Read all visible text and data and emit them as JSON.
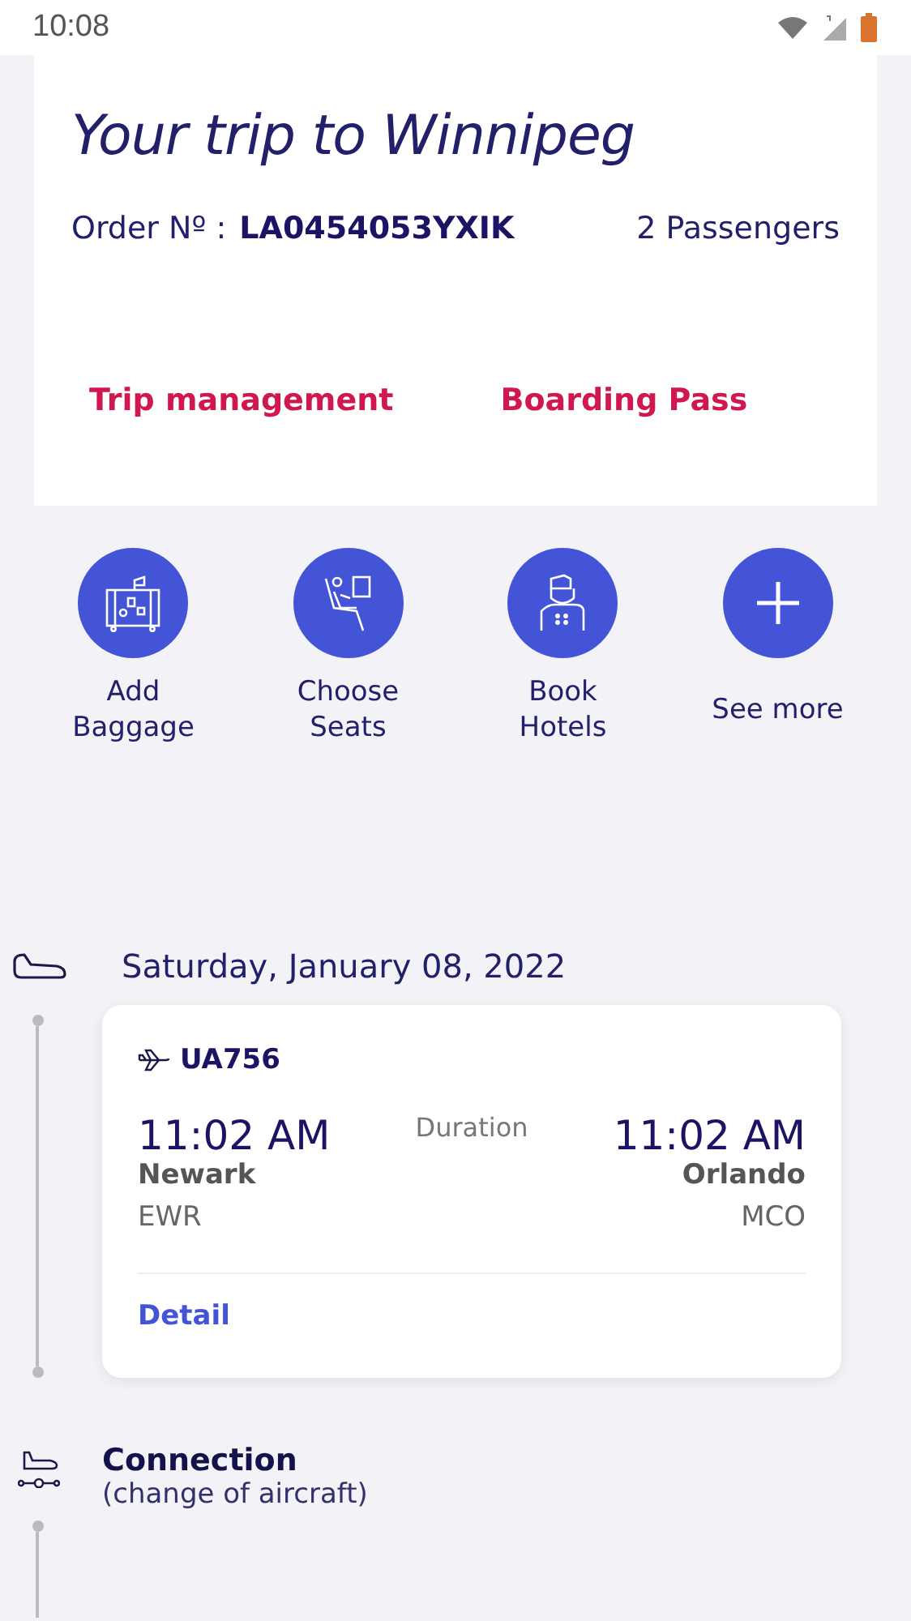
{
  "status_bar": {
    "time": "10:08"
  },
  "trip": {
    "title": "Your trip to Winnipeg",
    "order_label": "Order Nº :",
    "order_number": "LA0454053YXIK",
    "passengers": "2 Passengers",
    "links": [
      "Trip management",
      "Boarding Pass"
    ]
  },
  "actions": [
    {
      "kind": "baggage",
      "label": "Add\nBaggage"
    },
    {
      "kind": "seats",
      "label": "Choose\nSeats"
    },
    {
      "kind": "hotels",
      "label": "Book\nHotels"
    },
    {
      "kind": "more",
      "label": "See more"
    }
  ],
  "itinerary": {
    "date": "Saturday, January 08, 2022",
    "flight": {
      "number": "UA756",
      "departure_time": "11:02 AM",
      "duration_label": "Duration",
      "arrival_time": "11:02 AM",
      "origin_city": "Newark",
      "origin_code": "EWR",
      "destination_city": "Orlando",
      "destination_code": "MCO",
      "detail_link": "Detail"
    },
    "connection": {
      "title": "Connection",
      "note": "(change of aircraft)"
    }
  }
}
